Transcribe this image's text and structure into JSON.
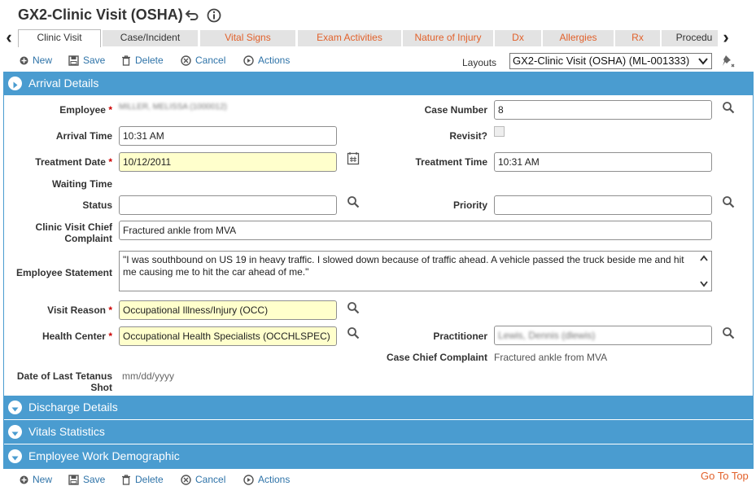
{
  "header": {
    "title": "GX2-Clinic Visit (OSHA)",
    "undo_icon": "undo-icon",
    "info_icon": "info-icon"
  },
  "tabs": [
    {
      "label": "Clinic Visit",
      "active": true
    },
    {
      "label": "Case/Incident"
    },
    {
      "label": "Vital Signs"
    },
    {
      "label": "Exam Activities"
    },
    {
      "label": "Nature of Injury"
    },
    {
      "label": "Dx"
    },
    {
      "label": "Allergies"
    },
    {
      "label": "Rx"
    },
    {
      "label": "Procedu"
    }
  ],
  "toolbar": {
    "new": "New",
    "save": "Save",
    "delete": "Delete",
    "cancel": "Cancel",
    "actions": "Actions",
    "layouts_label": "Layouts",
    "layouts_value": "GX2-Clinic Visit (OSHA) (ML-001333)"
  },
  "sections": {
    "arrival": "Arrival Details",
    "discharge": "Discharge Details",
    "vitals": "Vitals Statistics",
    "demographic": "Employee Work Demographic"
  },
  "form": {
    "employee_label": "Employee",
    "employee_value": "MILLER, MELISSA (1000012)",
    "case_number_label": "Case Number",
    "case_number_value": "8",
    "arrival_time_label": "Arrival Time",
    "arrival_time_value": "10:31 AM",
    "revisit_label": "Revisit?",
    "treatment_date_label": "Treatment Date",
    "treatment_date_value": "10/12/2011",
    "treatment_time_label": "Treatment Time",
    "treatment_time_value": "10:31 AM",
    "waiting_time_label": "Waiting Time",
    "status_label": "Status",
    "status_value": "",
    "priority_label": "Priority",
    "priority_value": "",
    "chief_complaint_label_1": "Clinic Visit Chief",
    "chief_complaint_label_2": "Complaint",
    "chief_complaint_value": "Fractured ankle from MVA",
    "employee_statement_label": "Employee Statement",
    "employee_statement_line1": "\"I was southbound on US 19 in heavy traffic. I slowed down because of traffic ahead. A vehicle passed the truck beside me and hit",
    "employee_statement_line2": "me causing me to hit the car ahead of me.\"",
    "visit_reason_label": "Visit Reason",
    "visit_reason_value": "Occupational Illness/Injury (OCC)",
    "health_center_label": "Health Center",
    "health_center_value": "Occupational Health Specialists (OCCHLSPEC)",
    "practitioner_label": "Practitioner",
    "practitioner_value": "Lewis, Dennis (dlewis)",
    "case_chief_label": "Case Chief Complaint",
    "case_chief_value": "Fractured ankle from MVA",
    "tetanus_label_1": "Date of Last Tetanus",
    "tetanus_label_2": "Shot",
    "tetanus_placeholder": "mm/dd/yyyy"
  },
  "footer": {
    "goto_top": "Go To Top"
  },
  "colors": {
    "section_blue": "#4a9cd0",
    "link_blue": "#2e73a8",
    "tab_orange": "#e2612b",
    "required_red": "#cc0000",
    "required_field_yellow": "#ffffcc"
  }
}
